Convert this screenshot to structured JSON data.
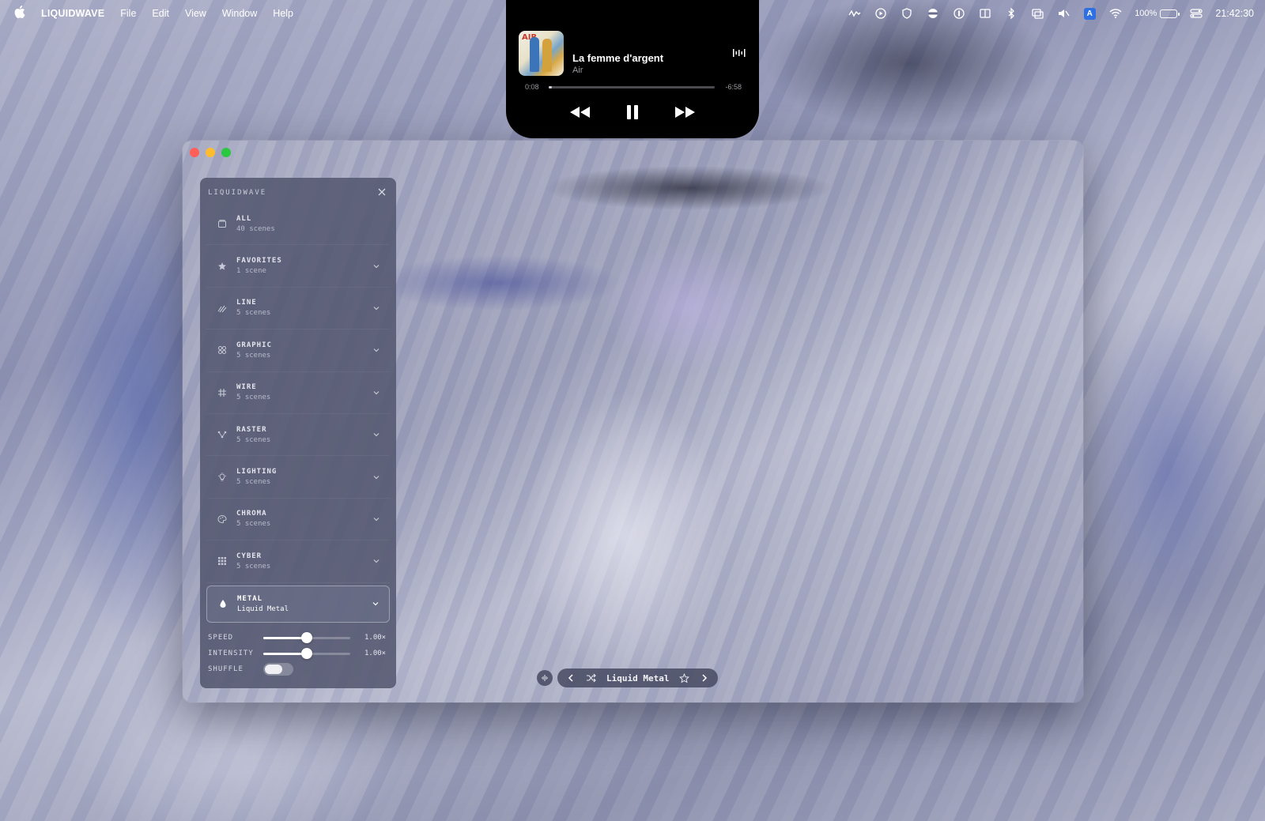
{
  "menubar": {
    "app_name": "LIQUIDWAVE",
    "menus": [
      "File",
      "Edit",
      "View",
      "Window",
      "Help"
    ],
    "battery_percent": "100%",
    "battery_level": 1.0,
    "input_source": "A",
    "clock": "21:42:30",
    "status_icons": [
      "waveform-icon",
      "play-circle-icon",
      "shield-icon",
      "stripes-icon",
      "password-icon",
      "split-view-icon",
      "bluetooth-icon",
      "screen-mirror-icon",
      "mute-icon",
      "input-source-icon",
      "wifi-icon",
      "battery-icon",
      "control-center-icon"
    ]
  },
  "now_playing": {
    "title": "La femme d'argent",
    "artist": "Air",
    "elapsed": "0:08",
    "remaining": "-6:58",
    "progress": 0.02,
    "album_logo": "AIR"
  },
  "window": {
    "panel": {
      "header": "LIQUIDWAVE",
      "categories": [
        {
          "name": "ALL",
          "count": "40 scenes",
          "icon": "folder-icon",
          "has_chevron": false
        },
        {
          "name": "FAVORITES",
          "count": "1 scene",
          "icon": "star-icon",
          "has_chevron": true
        },
        {
          "name": "LINE",
          "count": "5 scenes",
          "icon": "line-icon",
          "has_chevron": true
        },
        {
          "name": "GRAPHIC",
          "count": "5 scenes",
          "icon": "graphic-icon",
          "has_chevron": true
        },
        {
          "name": "WIRE",
          "count": "5 scenes",
          "icon": "grid-hash-icon",
          "has_chevron": true
        },
        {
          "name": "RASTER",
          "count": "5 scenes",
          "icon": "nodes-icon",
          "has_chevron": true
        },
        {
          "name": "LIGHTING",
          "count": "5 scenes",
          "icon": "bulb-icon",
          "has_chevron": true
        },
        {
          "name": "CHROMA",
          "count": "5 scenes",
          "icon": "palette-icon",
          "has_chevron": true
        },
        {
          "name": "CYBER",
          "count": "5 scenes",
          "icon": "matrix-icon",
          "has_chevron": true
        },
        {
          "name": "METAL",
          "count": "Liquid Metal",
          "icon": "droplet-icon",
          "has_chevron": true,
          "selected": true
        }
      ],
      "controls": {
        "speed_label": "SPEED",
        "speed_value": "1.00×",
        "speed_level": 0.5,
        "intensity_label": "INTENSITY",
        "intensity_value": "1.00×",
        "intensity_level": 0.5,
        "shuffle_label": "SHUFFLE",
        "shuffle_on": false
      }
    },
    "transport": {
      "scene_name": "Liquid Metal"
    }
  },
  "colors": {
    "close": "#ff5f57",
    "minimize": "#febc2e",
    "zoom": "#28c840",
    "panel_bg": "#545870"
  }
}
